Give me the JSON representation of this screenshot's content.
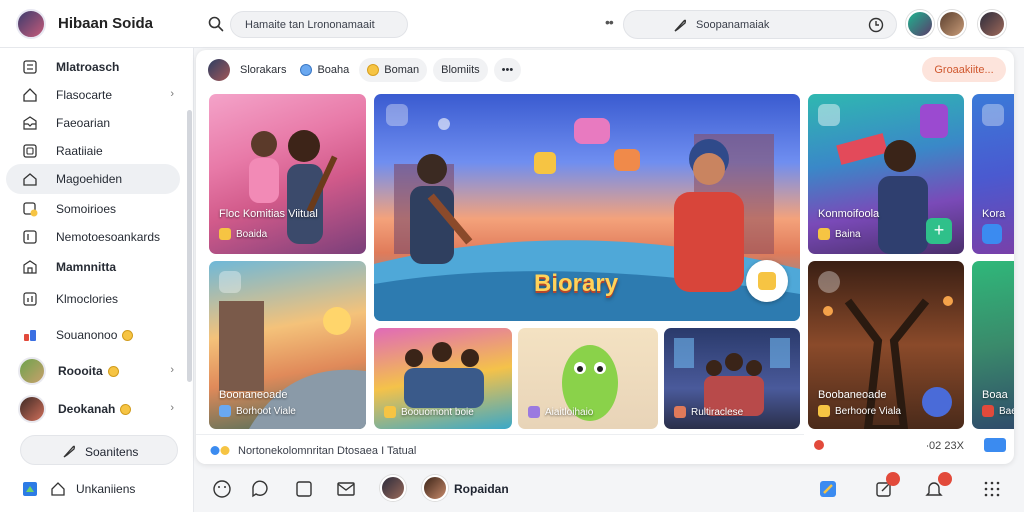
{
  "header": {
    "brand_name": "Hibaan Soida",
    "search_text": "Hamaite tan Lrononamaait",
    "search2_text": "Soopanamaiak"
  },
  "sidebar": {
    "items": [
      {
        "label": "Mlatroasch",
        "icon": "list-icon",
        "bold": true
      },
      {
        "label": "Flasocarte",
        "icon": "home-icon"
      },
      {
        "label": "Faeoarian",
        "icon": "inbox-icon"
      },
      {
        "label": "Raatiiaie",
        "icon": "square-icon"
      },
      {
        "label": "Magoehiden",
        "icon": "house-icon",
        "active": true
      },
      {
        "label": "Somoirioes",
        "icon": "badge-icon"
      },
      {
        "label": "Nemotoesoankards",
        "icon": "bookmark-icon"
      },
      {
        "label": "Mamnnitta",
        "icon": "building-icon",
        "bold": true
      },
      {
        "label": "Klmoclories",
        "icon": "chart-icon"
      },
      {
        "label": "Souanonoo",
        "icon": "shapes-icon"
      },
      {
        "label": "Roooita",
        "avatar": true
      },
      {
        "label": "Deokanah",
        "avatar": true
      }
    ],
    "button_label": "Soanitens",
    "footer_label": "Unkaniiens"
  },
  "main": {
    "chips": [
      "Slorakars",
      "Boaha",
      "Boman",
      "Blomiits"
    ],
    "more_chip": "•••",
    "action_pill": "Groaakiite...",
    "tiles": {
      "t1_title": "Floc Komitias Viitual",
      "t1_sub": "Boaida",
      "hero_title": "Biorary",
      "t3_title": "Konmoifoola",
      "t3_sub": "Baina",
      "t4_title": "Kora",
      "t5_title": "Boonaneoade",
      "t5_sub": "Borhoot Viale",
      "t6_sub": "Boouomont boie",
      "t7_sub": "Aiaitloihaio",
      "t8_sub": "Rultiraclese",
      "t9_title": "Boobaneoade",
      "t9_sub": "Berhoore Viala",
      "t10_title": "Boaa",
      "t10_sub": "Baea"
    },
    "bottom_text": "Nortonekolomnritan Dtosaea I Tatual",
    "right_stat": "∙02 23X"
  },
  "bottombar": {
    "name": "Ropaidan"
  },
  "colors": {
    "accent_orange": "#d0582f",
    "notification_red": "#e24a3b",
    "active_item_bg": "#eef0f3"
  }
}
